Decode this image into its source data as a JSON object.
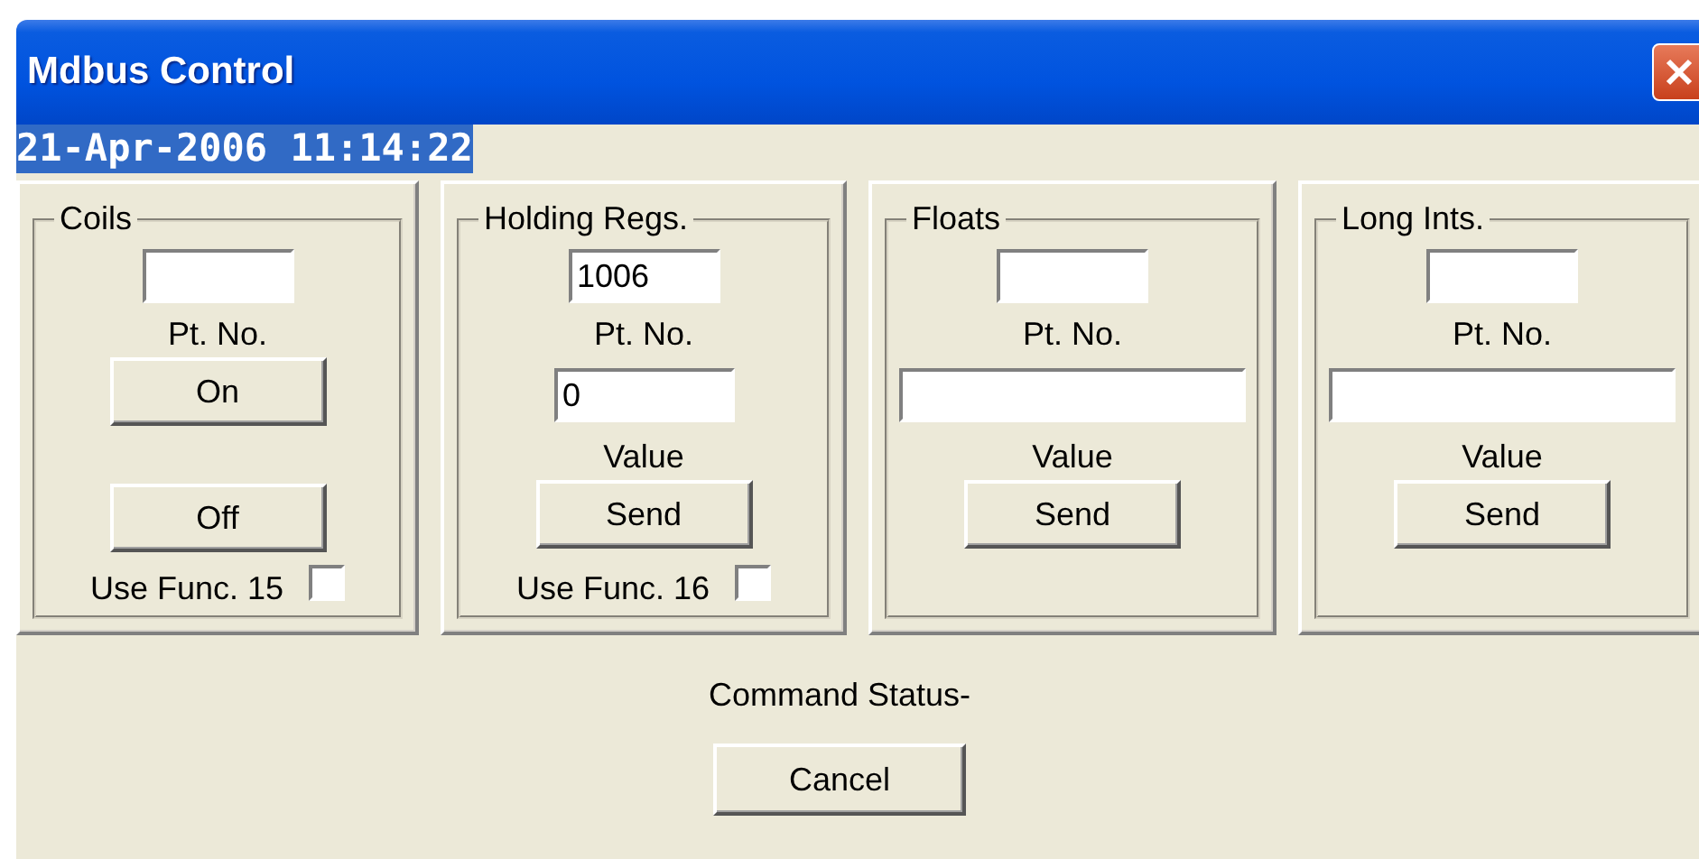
{
  "window": {
    "title": "Mdbus Control"
  },
  "timestamp": "21-Apr-2006 11:14:22",
  "panels": [
    {
      "kind": "coils",
      "legend": "Coils",
      "point_no": {
        "label": "Pt. No."
      },
      "buttons": [
        "On",
        "Off"
      ],
      "option": {
        "label": "Use Func. 15",
        "checked": false
      }
    },
    {
      "kind": "registers",
      "legend": "Holding Regs.",
      "point_no": {
        "value": "1006",
        "label": "Pt. No."
      },
      "value": {
        "value": "0",
        "label": "Value"
      },
      "buttons": [
        "Send"
      ],
      "option": {
        "label": "Use Func. 16",
        "checked": false
      }
    },
    {
      "kind": "wide",
      "legend": "Floats",
      "point_no": {
        "label": "Pt. No."
      },
      "value": {
        "label": "Value"
      },
      "buttons": [
        "Send"
      ]
    },
    {
      "kind": "wide",
      "legend": "Long Ints.",
      "point_no": {
        "label": "Pt. No."
      },
      "value": {
        "label": "Value"
      },
      "buttons": [
        "Send"
      ]
    }
  ],
  "status": {
    "label": "Command Status-"
  },
  "cancel_button": "Cancel"
}
